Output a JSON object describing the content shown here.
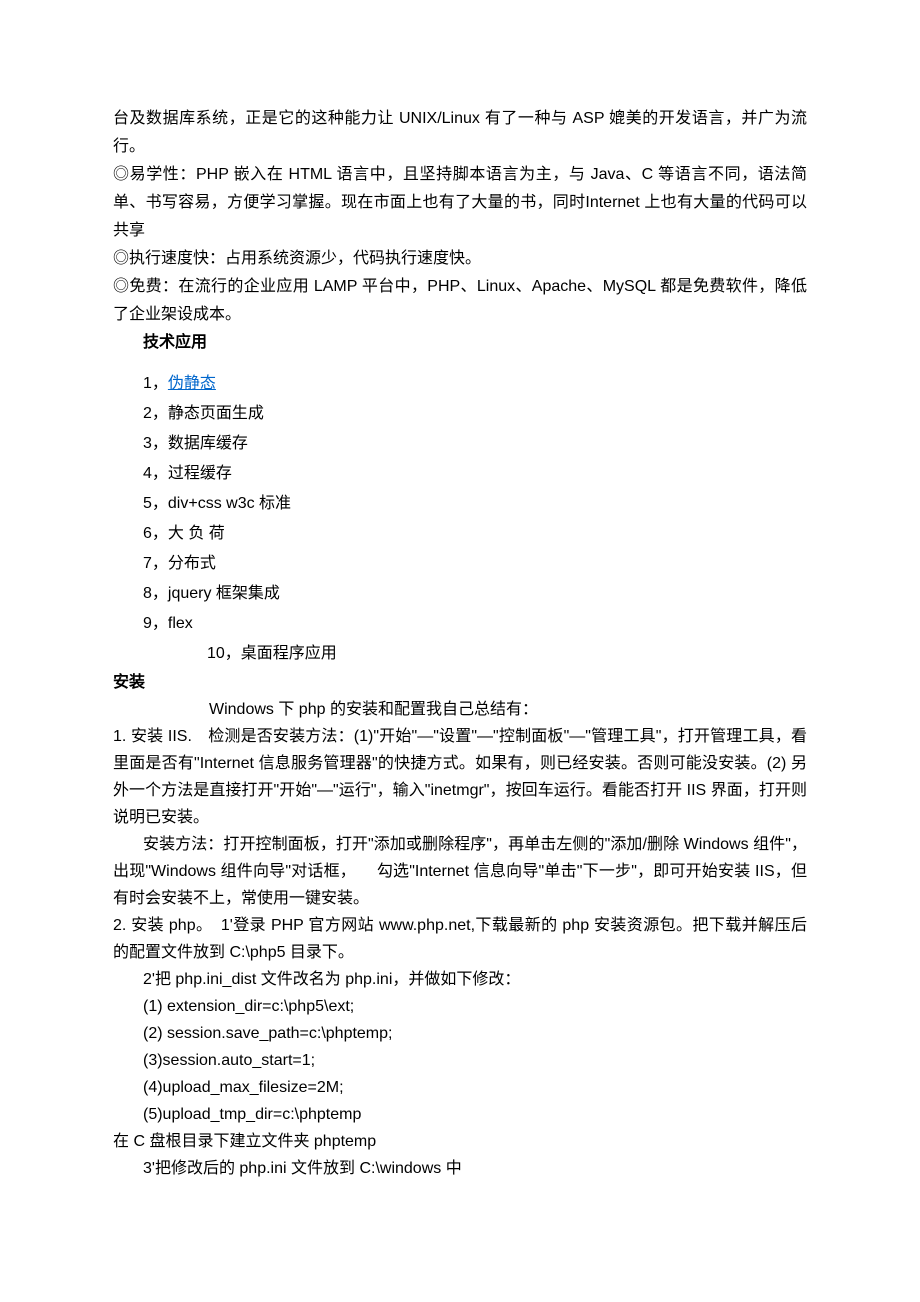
{
  "intro": {
    "p1": "台及数据库系统，正是它的这种能力让 UNIX/Linux 有了一种与 ASP 媲美的开发语言，并广为流行。",
    "p2": "◎易学性：PHP 嵌入在 HTML 语言中，且坚持脚本语言为主，与 Java、C 等语言不同，语法简单、书写容易，方便学习掌握。现在市面上也有了大量的书，同时Internet 上也有大量的代码可以共享",
    "p3": "◎执行速度快：占用系统资源少，代码执行速度快。",
    "p4": "◎免费：在流行的企业应用 LAMP 平台中，PHP、Linux、Apache、MySQL 都是免费软件，降低了企业架设成本。"
  },
  "tech": {
    "title": "技术应用",
    "items": [
      {
        "n": "1，",
        "text": "伪静态",
        "link": true
      },
      {
        "n": "2，",
        "text": "静态页面生成"
      },
      {
        "n": "3，",
        "text": "数据库缓存"
      },
      {
        "n": "4，",
        "text": "过程缓存"
      },
      {
        "n": "5，",
        "text": "div+css  w3c 标准"
      },
      {
        "n": "6，",
        "text": "大 负 荷"
      },
      {
        "n": "7，",
        "text": "分布式"
      },
      {
        "n": "8，",
        "text": "jquery 框架集成"
      },
      {
        "n": "9，",
        "text": "flex"
      }
    ],
    "item10": "10，桌面程序应用"
  },
  "install": {
    "title": "安装",
    "p0": "Windows 下 php 的安装和配置我自己总结有：",
    "p1": "1. 安装 IIS.　检测是否安装方法：(1)\"开始\"—\"设置\"—\"控制面板\"—\"管理工具\"，打开管理工具，看里面是否有\"Internet 信息服务管理器\"的快捷方式。如果有，则已经安装。否则可能没安装。(2) 另外一个方法是直接打开\"开始\"—\"运行\"，输入\"inetmgr\"，按回车运行。看能否打开 IIS 界面，打开则说明已安装。",
    "p2": "安装方法：打开控制面板，打开\"添加或删除程序\"，再单击左侧的\"添加/删除 Windows 组件\"，出现\"Windows 组件向导\"对话框， 　勾选\"Internet 信息向导\"单击\"下一步\"，即可开始安装 IIS，但有时会安装不上，常使用一键安装。",
    "p3": "2. 安装 php。　1'登录 PHP 官方网站 www.php.net,下载最新的 php 安装资源包。把下载并解压后的配置文件放到 C:\\php5 目录下。",
    "p4": "2'把 php.ini_dist 文件改名为 php.ini，并做如下修改：",
    "c1": "(1) extension_dir=c:\\php5\\ext;",
    "c2": "(2) session.save_path=c:\\phptemp;",
    "c3": "(3)session.auto_start=1;",
    "c4": "(4)upload_max_filesize=2M;",
    "c5": "(5)upload_tmp_dir=c:\\phptemp",
    "p5": "在 C 盘根目录下建立文件夹 phptemp",
    "p6": "3'把修改后的 php.ini 文件放到 C:\\windows 中"
  }
}
